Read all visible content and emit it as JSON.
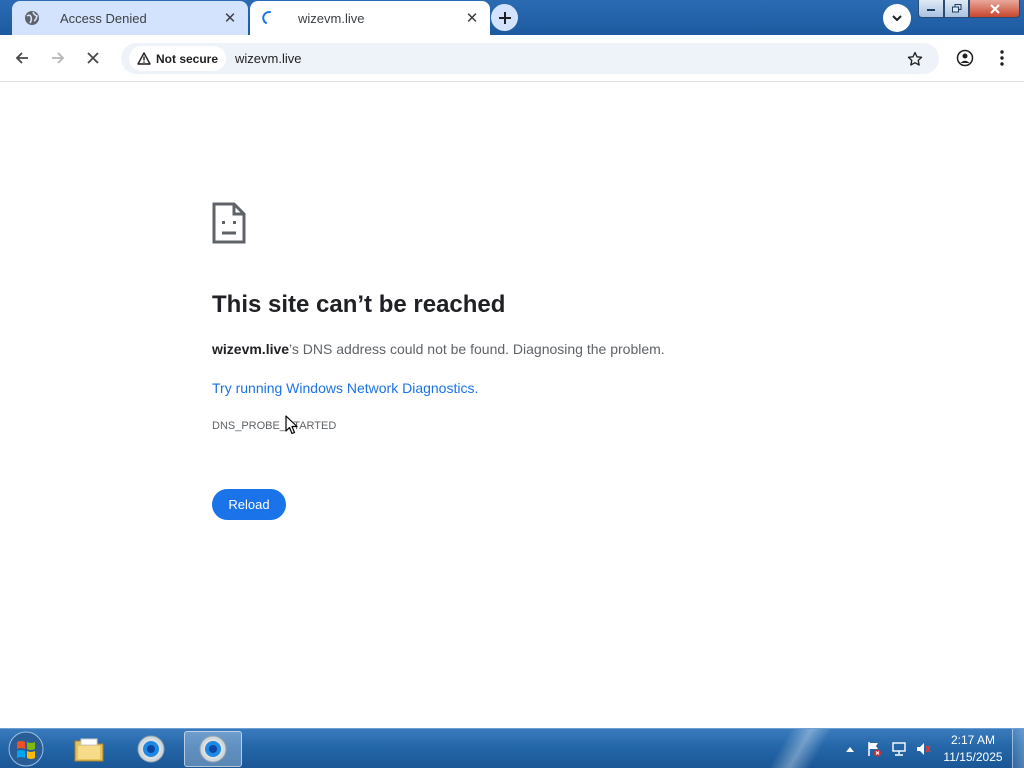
{
  "browser": {
    "tabs": [
      {
        "title": "Access Denied",
        "active": false,
        "icon": "globe-icon"
      },
      {
        "title": "wizevm.live",
        "active": true,
        "icon": "loading-spinner-icon"
      }
    ],
    "address_bar": {
      "security_label": "Not secure",
      "url": "wizevm.live"
    }
  },
  "error_page": {
    "title": "This site can’t be reached",
    "description_host": "wizevm.live",
    "description_rest": "’s DNS address could not be found. Diagnosing the problem.",
    "suggestion_link": "Try running Windows Network Diagnostics.",
    "error_code": "DNS_PROBE_STARTED",
    "reload_label": "Reload"
  },
  "taskbar": {
    "pinned": [
      {
        "name": "file-explorer",
        "active": false
      },
      {
        "name": "chrome",
        "active": false
      },
      {
        "name": "chrome",
        "active": true
      }
    ],
    "clock": {
      "time": "2:17 AM",
      "date": "11/15/2025"
    }
  },
  "colors": {
    "link": "#1a73e8",
    "button": "#1a73e8",
    "title": "#202124",
    "tab_strip": "#1f5fa6"
  }
}
